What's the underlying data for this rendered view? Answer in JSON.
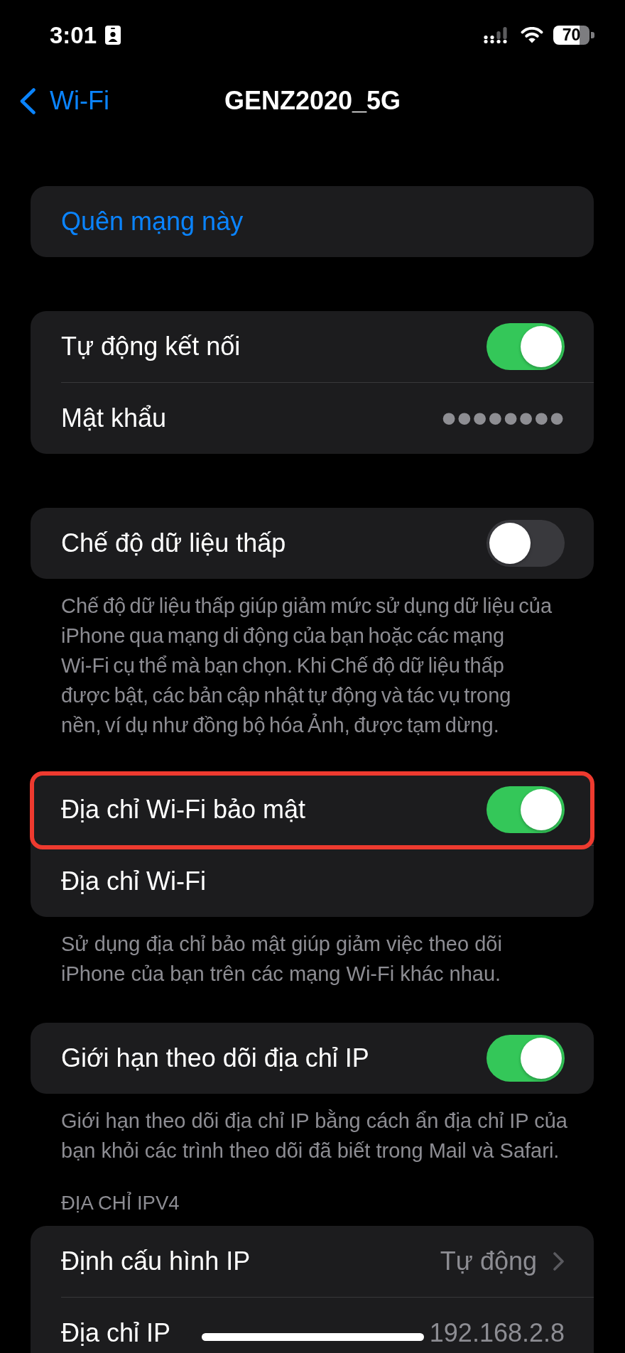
{
  "status_bar": {
    "time": "3:01",
    "battery": "70"
  },
  "nav_bar": {
    "back_label": "Wi-Fi",
    "title": "GENZ2020_5G"
  },
  "groups": [
    {
      "rows": [
        {
          "kind": "action",
          "label": "Quên mạng này",
          "highlighted": false
        }
      ]
    },
    {
      "rows": [
        {
          "kind": "toggle",
          "label": "Tự động kết nối",
          "on": true,
          "highlighted": false
        },
        {
          "kind": "secret",
          "label": "Mật khẩu",
          "value": "••••••••",
          "highlighted": false
        }
      ]
    },
    {
      "rows": [
        {
          "kind": "toggle",
          "label": "Chế độ dữ liệu thấp",
          "on": false,
          "highlighted": false
        }
      ],
      "footer": "Chế độ dữ liệu thấp giúp giảm mức sử dụng dữ liệu của iPhone qua mạng di động của bạn hoặc các mạng Wi-Fi cụ thể mà bạn chọn. Khi Chế độ dữ liệu thấp được bật, các bản cập nhật tự động và tác vụ trong nền, ví dụ như đồng bộ hóa Ảnh, được tạm dừng."
    },
    {
      "rows": [
        {
          "kind": "toggle",
          "label": "Địa chỉ Wi-Fi bảo mật",
          "on": true,
          "highlighted": true
        },
        {
          "kind": "plain",
          "label": "Địa chỉ Wi-Fi",
          "highlighted": false
        }
      ],
      "footer": "Sử dụng địa chỉ bảo mật giúp giảm việc theo dõi iPhone của bạn trên các mạng Wi-Fi khác nhau."
    },
    {
      "rows": [
        {
          "kind": "toggle",
          "label": "Giới hạn theo dõi địa chỉ IP",
          "on": true,
          "highlighted": false
        }
      ],
      "footer": "Giới hạn theo dõi địa chỉ IP bằng cách ẩn địa chỉ IP của bạn khỏi các trình theo dõi đã biết trong Mail và Safari."
    },
    {
      "header": "ĐỊA CHỈ IPV4",
      "rows": [
        {
          "kind": "link",
          "label": "Định cấu hình IP",
          "value": "Tự động",
          "highlighted": false
        },
        {
          "kind": "info",
          "label": "Địa chỉ IP",
          "value": "192.168.2.8",
          "highlighted": false
        }
      ]
    }
  ]
}
